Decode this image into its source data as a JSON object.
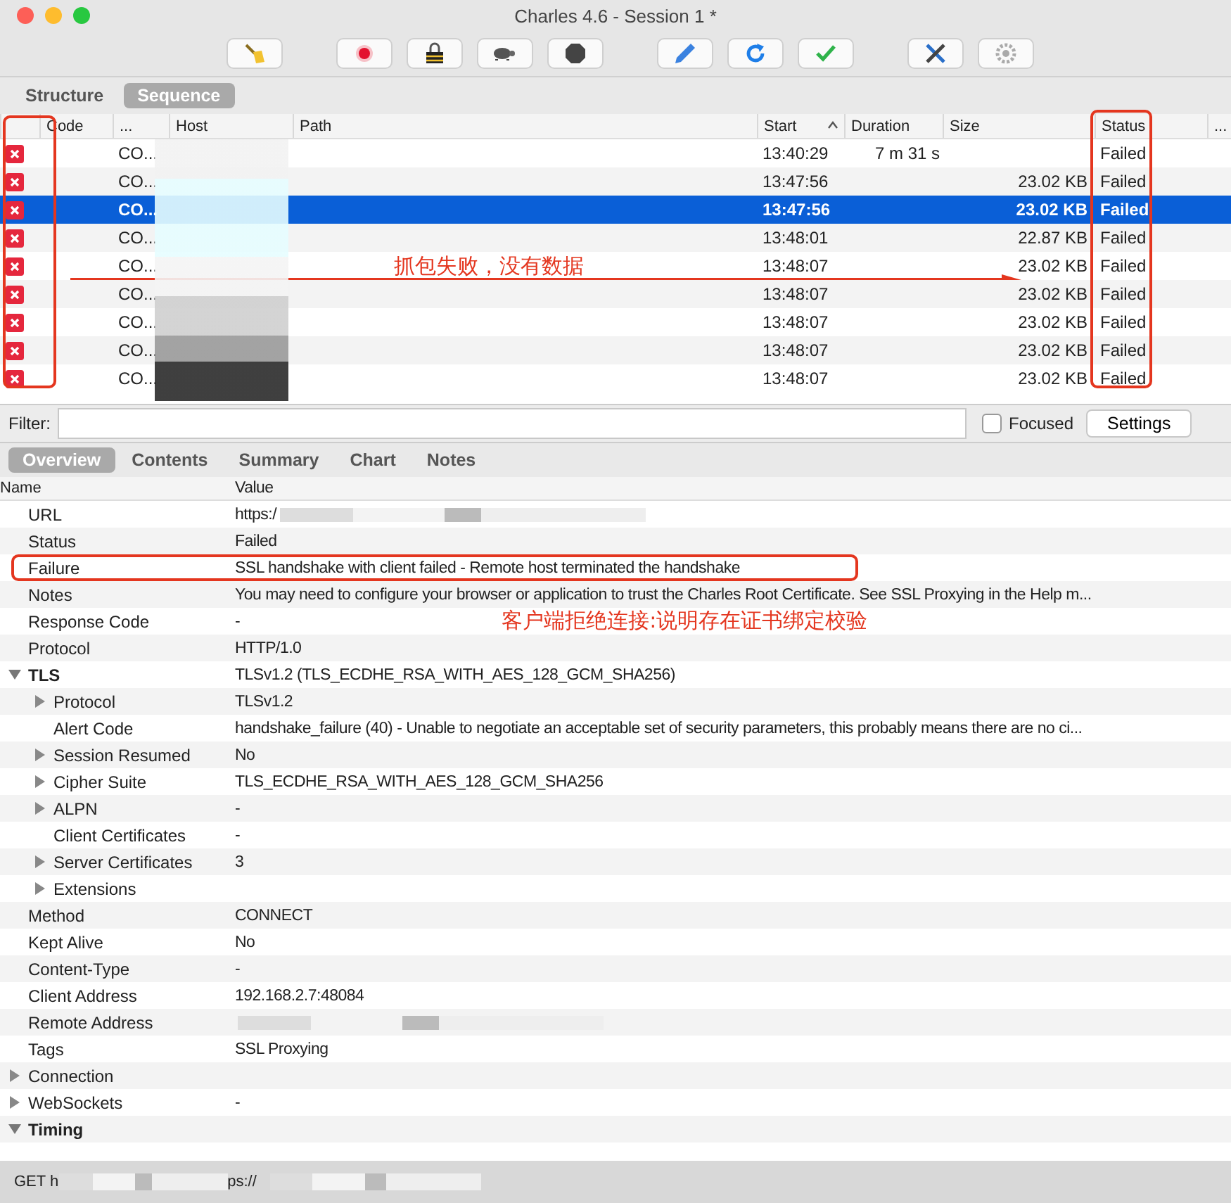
{
  "window": {
    "title": "Charles 4.6 - Session 1 *"
  },
  "toolbar": [
    {
      "kind": "broom"
    },
    {
      "kind": "record"
    },
    {
      "kind": "lock"
    },
    {
      "kind": "turtle"
    },
    {
      "kind": "stop"
    },
    {
      "kind": "pen"
    },
    {
      "kind": "refresh"
    },
    {
      "kind": "check"
    },
    {
      "kind": "tools"
    },
    {
      "kind": "gear"
    }
  ],
  "view_tabs": [
    {
      "label": "Structure",
      "selected": false
    },
    {
      "label": "Sequence",
      "selected": true
    }
  ],
  "table": {
    "columns": [
      {
        "label": "Code",
        "sorted": false
      },
      {
        "label": "...",
        "sorted": false
      },
      {
        "label": "Host",
        "sorted": false
      },
      {
        "label": "Path",
        "sorted": false
      },
      {
        "label": "Start",
        "sorted": true
      },
      {
        "label": "Duration",
        "sorted": false
      },
      {
        "label": "Size",
        "sorted": false
      },
      {
        "label": "Status",
        "sorted": false
      },
      {
        "label": "...",
        "sorted": false
      }
    ],
    "annotation": "抓包失败，没有数据",
    "rows": [
      {
        "code": "CO...",
        "start": "13:40:29",
        "duration": "7 m 31 s",
        "size": "",
        "status": "Failed",
        "selected": false
      },
      {
        "code": "CO...",
        "start": "13:47:56",
        "duration": "",
        "size": "23.02 KB",
        "status": "Failed",
        "selected": false
      },
      {
        "code": "CO...",
        "start": "13:47:56",
        "duration": "",
        "size": "23.02 KB",
        "status": "Failed",
        "selected": true
      },
      {
        "code": "CO...",
        "start": "13:48:01",
        "duration": "",
        "size": "22.87 KB",
        "status": "Failed",
        "selected": false
      },
      {
        "code": "CO...",
        "start": "13:48:07",
        "duration": "",
        "size": "23.02 KB",
        "status": "Failed",
        "selected": false
      },
      {
        "code": "CO...",
        "start": "13:48:07",
        "duration": "",
        "size": "23.02 KB",
        "status": "Failed",
        "selected": false
      },
      {
        "code": "CO...",
        "start": "13:48:07",
        "duration": "",
        "size": "23.02 KB",
        "status": "Failed",
        "selected": false
      },
      {
        "code": "CO...",
        "start": "13:48:07",
        "duration": "",
        "size": "23.02 KB",
        "status": "Failed",
        "selected": false
      },
      {
        "code": "CO...",
        "start": "13:48:07",
        "duration": "",
        "size": "23.02 KB",
        "status": "Failed",
        "selected": false
      }
    ]
  },
  "filter": {
    "label": "Filter:",
    "focused_label": "Focused",
    "focused_checked": false,
    "settings_button": "Settings"
  },
  "detail_tabs": [
    {
      "label": "Overview",
      "selected": true
    },
    {
      "label": "Contents",
      "selected": false
    },
    {
      "label": "Summary",
      "selected": false
    },
    {
      "label": "Chart",
      "selected": false
    },
    {
      "label": "Notes",
      "selected": false
    }
  ],
  "properties": {
    "columns": [
      "Name",
      "Value"
    ],
    "items": [
      {
        "kind": "leaf",
        "name": "URL",
        "value": "https:/",
        "redacted": true
      },
      {
        "kind": "leaf",
        "name": "Status",
        "value": "Failed"
      },
      {
        "kind": "leaf",
        "name": "Failure",
        "value": "SSL handshake with client failed - Remote host terminated the handshake"
      },
      {
        "kind": "leaf",
        "name": "Notes",
        "value": "You may need to configure your browser or application to trust the Charles Root Certificate. See SSL Proxying in the Help m..."
      },
      {
        "kind": "leaf",
        "name": "Response Code",
        "value": "-"
      },
      {
        "kind": "leaf",
        "name": "Protocol",
        "value": "HTTP/1.0"
      },
      {
        "kind": "node",
        "name": "TLS",
        "value": "TLSv1.2 (TLS_ECDHE_RSA_WITH_AES_128_GCM_SHA256)",
        "expanded": true,
        "children": [
          {
            "kind": "node",
            "name": "Protocol",
            "value": "TLSv1.2",
            "expanded": false
          },
          {
            "kind": "leaf",
            "name": "Alert Code",
            "value": "handshake_failure (40) - Unable to negotiate an acceptable set of security parameters, this probably means there are no ci..."
          },
          {
            "kind": "node",
            "name": "Session Resumed",
            "value": "No",
            "expanded": false
          },
          {
            "kind": "node",
            "name": "Cipher Suite",
            "value": "TLS_ECDHE_RSA_WITH_AES_128_GCM_SHA256",
            "expanded": false
          },
          {
            "kind": "node",
            "name": "ALPN",
            "value": "-",
            "expanded": false
          },
          {
            "kind": "leaf",
            "name": "Client Certificates",
            "value": "-"
          },
          {
            "kind": "node",
            "name": "Server Certificates",
            "value": "3",
            "expanded": false
          },
          {
            "kind": "node",
            "name": "Extensions",
            "expanded": false
          }
        ]
      },
      {
        "kind": "leaf",
        "name": "Method",
        "value": "CONNECT"
      },
      {
        "kind": "leaf",
        "name": "Kept Alive",
        "value": "No"
      },
      {
        "kind": "leaf",
        "name": "Content-Type",
        "value": "-"
      },
      {
        "kind": "leaf",
        "name": "Client Address",
        "value": "192.168.2.7:48084"
      },
      {
        "kind": "leaf",
        "name": "Remote Address",
        "redacted": true
      },
      {
        "kind": "leaf",
        "name": "Tags",
        "value": "SSL Proxying"
      },
      {
        "kind": "node",
        "name": "Connection",
        "expanded": false
      },
      {
        "kind": "node",
        "name": "WebSockets",
        "value": "-",
        "expanded": false
      },
      {
        "kind": "node",
        "name": "Timing",
        "expanded": true
      }
    ],
    "annotation": "客户端拒绝连接:说明存在证书绑定校验"
  },
  "status_bar": {
    "method": "GET h",
    "url_end": "ps://"
  }
}
